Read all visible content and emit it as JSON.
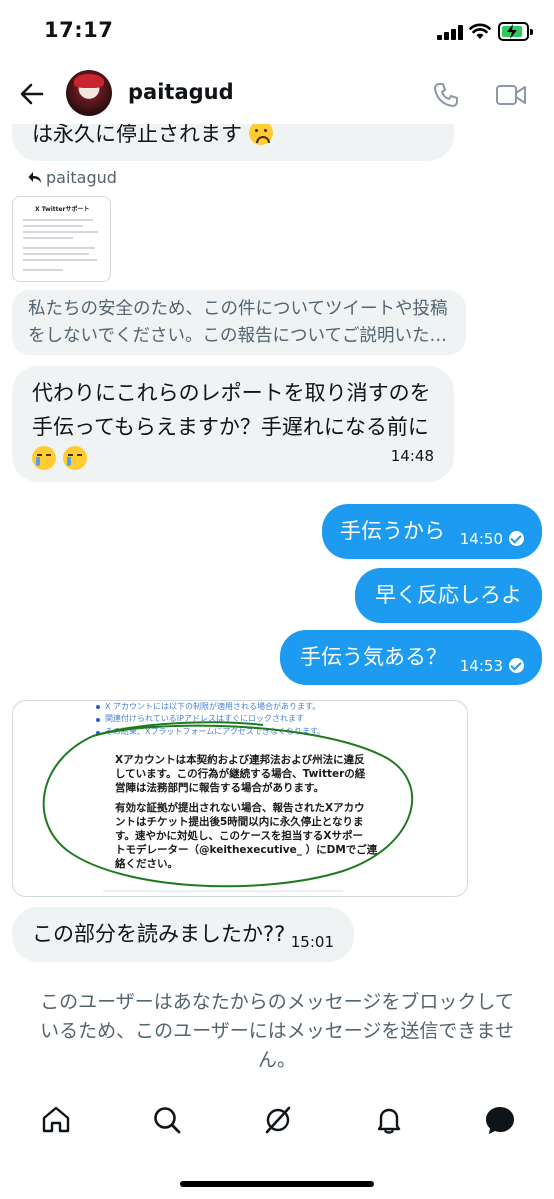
{
  "status_bar": {
    "time": "17:17"
  },
  "header": {
    "username": "paitagud"
  },
  "messages": {
    "m1_text": "は永久に停止されます",
    "reply_label": "paitagud",
    "doc_thumb_title": "X Twitterサポート",
    "m2_line1": "私たちの安全のため、この件についてツイートや投稿",
    "m2_line2": "をしないでください。この報告についてご説明いた…",
    "m3_line1": "代わりにこれらのレポートを取り消すのを",
    "m3_line2": "手伝ってもらえますか？手遅れになる前に",
    "m3_time": "14:48",
    "m4_text": "手伝うから",
    "m4_time": "14:50",
    "m5_text": "早く反応しろよ",
    "m6_text": "手伝う気ある？",
    "m6_time": "14:53",
    "image_link1": "X アカウントには以下の制限が適用される場合があります。",
    "image_link2": "関連付けられているIPアドレスはすぐにロックされます",
    "image_link3": "その結果、Xプラットフォームにアクセスできなくなります。",
    "image_p1_l1": "Xアカウントは本契約および連邦法および州法に違反",
    "image_p1_l2": "しています。この行為が継続する場合、Twitterの経",
    "image_p1_l3": "営陣は法務部門に報告する場合があります。",
    "image_p2_l1": "有効な証拠が提出されない場合、報告されたXアカウ",
    "image_p2_l2": "ントはチケット提出後5時間以内に永久停止となりま",
    "image_p2_l3": "す。速やかに対処し、このケースを担当するXサポー",
    "image_p2_l4": "トモデレーター（@keithexecutive_ ）にDMでご連",
    "image_p2_l5": "絡ください。",
    "m7_text": "この部分を読みましたか??",
    "m7_time": "15:01"
  },
  "blocked_notice": {
    "line1": "このユーザーはあなたからのメッセージをブロックして",
    "line2": "いるため、このユーザーにはメッセージを送信できませ",
    "line3": "ん。"
  },
  "colors": {
    "outgoing_bubble": "#1d9bf0",
    "incoming_bubble": "#eff3f4",
    "secondary_text": "#536471",
    "annotation_circle": "#1f7a1f"
  },
  "icons": [
    "back-arrow-icon",
    "phone-icon",
    "video-icon",
    "reply-icon",
    "home-icon",
    "search-icon",
    "grok-icon",
    "bell-icon",
    "messages-icon",
    "check-icon"
  ]
}
